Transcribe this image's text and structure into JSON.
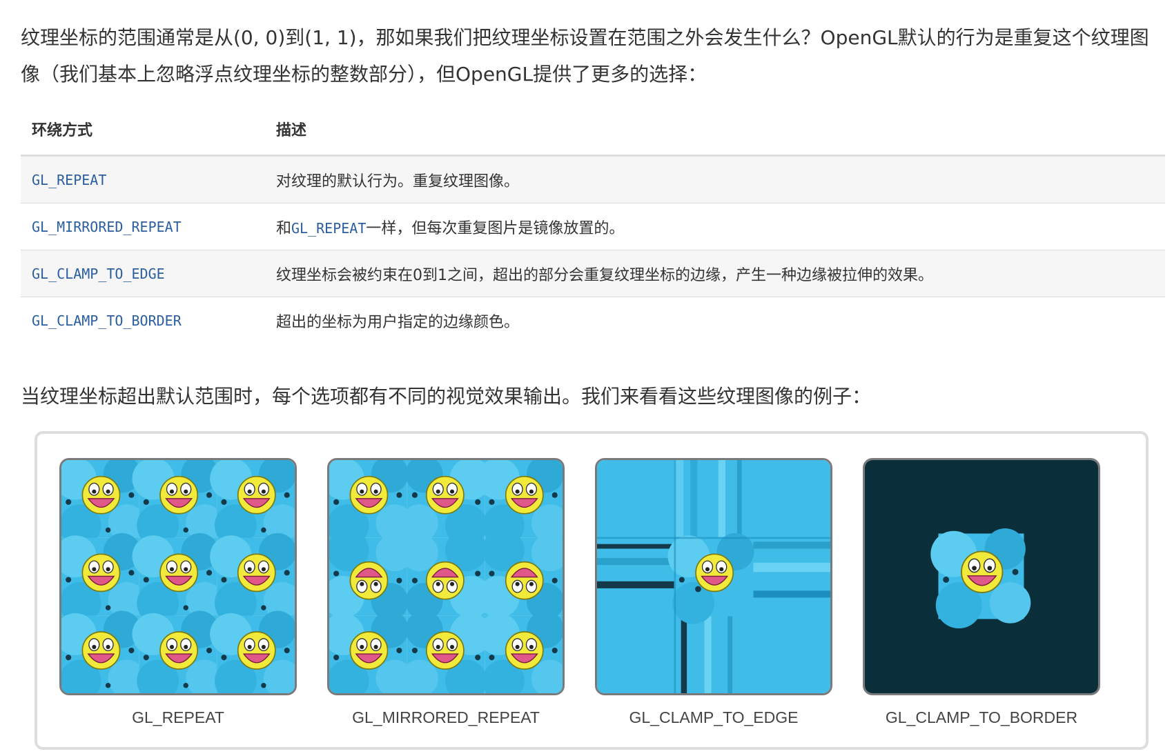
{
  "intro_text": "纹理坐标的范围通常是从(0, 0)到(1, 1)，那如果我们把纹理坐标设置在范围之外会发生什么？OpenGL默认的行为是重复这个纹理图像（我们基本上忽略浮点纹理坐标的整数部分），但OpenGL提供了更多的选择：",
  "table": {
    "headers": [
      "环绕方式",
      "描述"
    ],
    "rows": [
      {
        "mode": "GL_REPEAT",
        "desc": "对纹理的默认行为。重复纹理图像。"
      },
      {
        "mode": "GL_MIRRORED_REPEAT",
        "desc_pre": "和",
        "desc_code": "GL_REPEAT",
        "desc_post": "一样，但每次重复图片是镜像放置的。"
      },
      {
        "mode": "GL_CLAMP_TO_EDGE",
        "desc": "纹理坐标会被约束在0到1之间，超出的部分会重复纹理坐标的边缘，产生一种边缘被拉伸的效果。"
      },
      {
        "mode": "GL_CLAMP_TO_BORDER",
        "desc": "超出的坐标为用户指定的边缘颜色。"
      }
    ]
  },
  "para2": "当纹理坐标超出默认范围时，每个选项都有不同的视觉效果输出。我们来看看这些纹理图像的例子：",
  "figure": {
    "captions": [
      "GL_REPEAT",
      "GL_MIRRORED_REPEAT",
      "GL_CLAMP_TO_EDGE",
      "GL_CLAMP_TO_BORDER"
    ],
    "colors": {
      "texture_blue": "#3fbde8",
      "texture_light": "#7fd8f5",
      "face_yellow": "#f2ea3a",
      "border_color": "#0a2e3a"
    }
  }
}
